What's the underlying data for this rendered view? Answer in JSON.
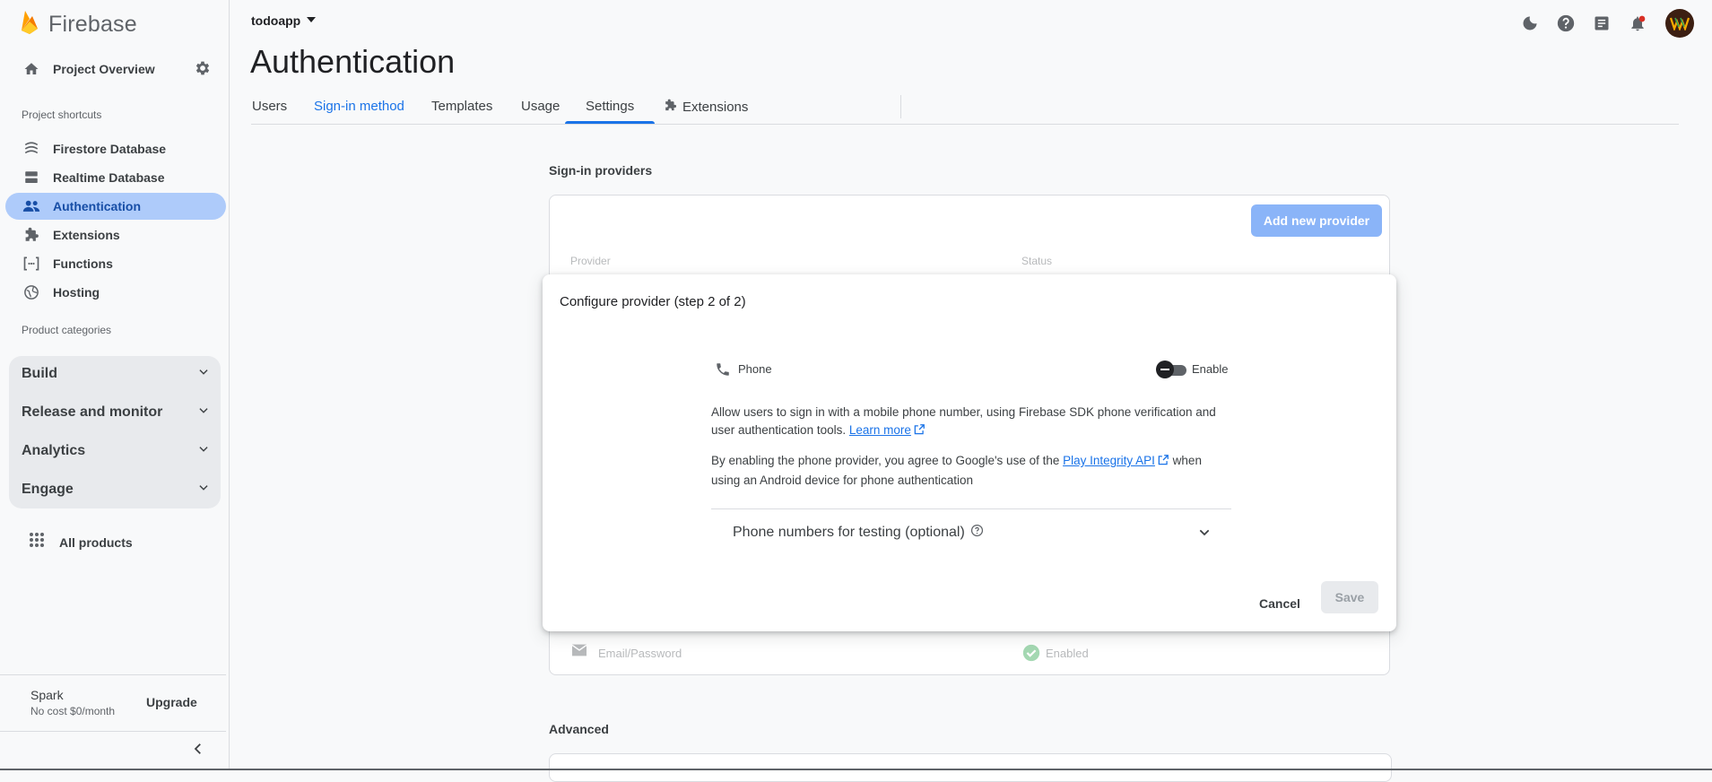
{
  "sidebar": {
    "brand": "Firebase",
    "project_overview": "Project Overview",
    "shortcuts_title": "Project shortcuts",
    "shortcuts": [
      {
        "label": "Firestore Database",
        "icon": "firestore-icon"
      },
      {
        "label": "Realtime Database",
        "icon": "database-icon"
      },
      {
        "label": "Authentication",
        "icon": "people-icon"
      },
      {
        "label": "Extensions",
        "icon": "extensions-icon"
      },
      {
        "label": "Functions",
        "icon": "functions-icon"
      },
      {
        "label": "Hosting",
        "icon": "globe-icon"
      }
    ],
    "categories_title": "Product categories",
    "categories": [
      {
        "label": "Build"
      },
      {
        "label": "Release and monitor"
      },
      {
        "label": "Analytics"
      },
      {
        "label": "Engage"
      }
    ],
    "all_products": "All products",
    "plan_name": "Spark",
    "plan_sub": "No cost $0/month",
    "upgrade": "Upgrade"
  },
  "header": {
    "project": "todoapp",
    "title": "Authentication",
    "tabs": [
      {
        "label": "Users"
      },
      {
        "label": "Sign-in method"
      },
      {
        "label": "Templates"
      },
      {
        "label": "Usage"
      },
      {
        "label": "Settings"
      },
      {
        "label": "Extensions"
      }
    ]
  },
  "main": {
    "providers_heading": "Sign-in providers",
    "add_provider": "Add new provider",
    "col_provider": "Provider",
    "col_status": "Status",
    "email_provider": "Email/Password",
    "email_status": "Enabled",
    "advanced_heading": "Advanced"
  },
  "dialog": {
    "title": "Configure provider (step 2 of 2)",
    "provider_name": "Phone",
    "enable_label": "Enable",
    "desc1_before": "Allow users to sign in with a mobile phone number, using Firebase SDK phone verification and user authentication tools. ",
    "learn_more": "Learn more",
    "desc2_before": "By enabling the phone provider, you agree to Google's use of the ",
    "play_integrity": "Play Integrity API",
    "desc2_after": " when using an Android device for phone authentication",
    "phone_testing": "Phone numbers for testing (optional)",
    "cancel": "Cancel",
    "save": "Save"
  },
  "colors": {
    "accent": "#1a73e8",
    "active_nav": "#aecbfa",
    "brand_orange": "#ffa000"
  }
}
